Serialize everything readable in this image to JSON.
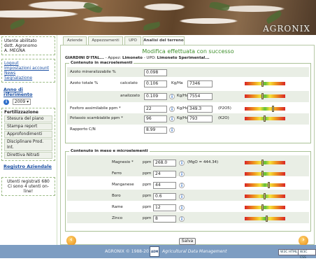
{
  "brand": {
    "name": "AGRONIX"
  },
  "user": {
    "line1": "Utente abilitato",
    "line2": "dott. Agronomo",
    "line3": "A. MEGNA"
  },
  "account_links": [
    "Logout",
    "Impostazioni account",
    "News",
    "Segnalazione"
  ],
  "year": {
    "heading": "Anno di riferimento",
    "value": "2009"
  },
  "fert": {
    "heading": "Fertilizzazione",
    "items": [
      "Stesura del piano",
      "Stampa report",
      "Approfondimenti",
      "Disciplinare Prod. Int.",
      "Direttiva Nitrati"
    ]
  },
  "registry": {
    "label": "Registro Aziendale"
  },
  "users_online": {
    "line1": "Utenti registrati 680",
    "line2": "Ci sono 4 utenti on-line!"
  },
  "tabs": [
    "Aziende",
    "Appezzamenti",
    "UPO",
    "Analisi del terreno"
  ],
  "main": {
    "message": "Modifica effettuata con successo",
    "crumb_a": "GIARDINI D'ITAL...",
    "crumb_b": " - Appez: ",
    "crumb_c": "Limoneto",
    "crumb_d": " - UPO: ",
    "crumb_e": "Limoneto Sperimental..."
  },
  "macro": {
    "legend": "Contenuto in macroelementi",
    "azoto_min": {
      "label": "Azoto mineralizzabile %",
      "value": "0.098"
    },
    "azoto_tot": {
      "label": "Azoto totale %",
      "calc_label": "calcolato",
      "calc_value": "0.106",
      "calc_unit": "Kg/Ha",
      "calc_kg": "7346",
      "an_label": "analizzato",
      "an_value": "0.109",
      "an_unit": "Kg/Ha",
      "an_kg": "7554"
    },
    "fosforo": {
      "label": "Fosforo assimilabile ppm *",
      "value": "22",
      "unit": "Kg/Ha",
      "kg": "349.3",
      "formula": "(P2O5)"
    },
    "potassio": {
      "label": "Potassio scambiabile ppm *",
      "value": "96",
      "unit": "Kg/Ha",
      "kg": "793",
      "formula": "(K2O)"
    },
    "cn": {
      "label": "Rapporto C/N",
      "value": "8.99"
    },
    "gauge_levels": [
      0.45,
      0.45,
      0.7,
      0.5
    ]
  },
  "micro": {
    "legend": "Contenuto in meso e microelementi",
    "unit": "ppm",
    "mgo": "(MgO = 444.34)",
    "rows": [
      {
        "label": "Magnesio *",
        "value": "268.0",
        "level": 0.45
      },
      {
        "label": "Ferro",
        "value": "24",
        "level": 0.45
      },
      {
        "label": "Manganese",
        "value": "44",
        "level": 0.6
      },
      {
        "label": "Boro",
        "value": "0.6",
        "level": 0.5
      },
      {
        "label": "Rame",
        "value": "12",
        "level": 0.45
      },
      {
        "label": "Zinco",
        "value": "8",
        "level": 0.55
      }
    ]
  },
  "buttons": {
    "save": "Salva",
    "prev": "‹",
    "next": "›"
  },
  "info_glyph": "i",
  "footer": {
    "text1": "AGRONIX  © 1988-2010",
    "text2": "Agricultural Data Management",
    "logo": "ADM",
    "badge1": "W3C HTML 4.01",
    "badge2": "W3C CSS"
  }
}
